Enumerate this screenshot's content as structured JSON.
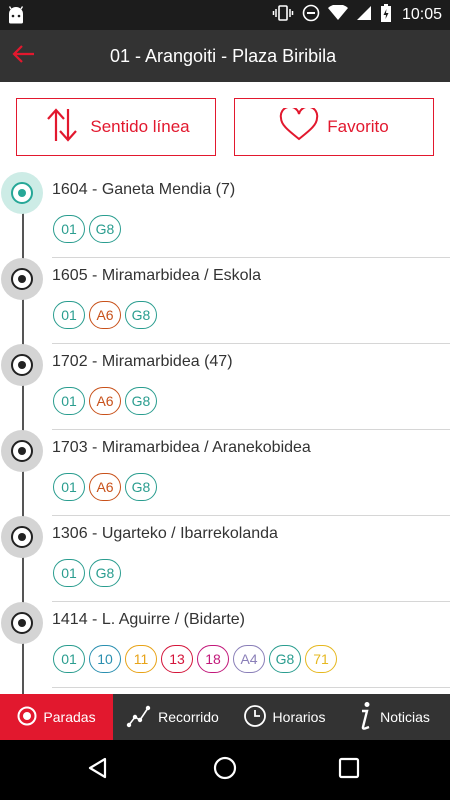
{
  "status_bar": {
    "time": "10:05",
    "icons": [
      "android-icon",
      "vibrate-icon",
      "minus-circle-icon",
      "wifi-icon",
      "signal-icon",
      "battery-icon"
    ]
  },
  "app_bar": {
    "title": "01 - Arangoiti - Plaza Biribila",
    "back_icon": "arrow-left-icon"
  },
  "actions": {
    "direction_label": "Sentido línea",
    "favorite_label": "Favorito"
  },
  "colors": {
    "accent": "#e2182e",
    "bar": "#333333",
    "active_stop": "#26a797"
  },
  "stops": [
    {
      "name": "1604 - Ganeta Mendia (7)",
      "active": true,
      "lines": [
        {
          "label": "01",
          "color": "#2a9d8f"
        },
        {
          "label": "G8",
          "color": "#2a9d8f"
        }
      ]
    },
    {
      "name": "1605 - Miramarbidea / Eskola",
      "active": false,
      "lines": [
        {
          "label": "01",
          "color": "#2a9d8f"
        },
        {
          "label": "A6",
          "color": "#c8511a"
        },
        {
          "label": "G8",
          "color": "#2a9d8f"
        }
      ]
    },
    {
      "name": "1702 - Miramarbidea (47)",
      "active": false,
      "lines": [
        {
          "label": "01",
          "color": "#2a9d8f"
        },
        {
          "label": "A6",
          "color": "#c8511a"
        },
        {
          "label": "G8",
          "color": "#2a9d8f"
        }
      ]
    },
    {
      "name": "1703 - Miramarbidea / Aranekobidea",
      "active": false,
      "lines": [
        {
          "label": "01",
          "color": "#2a9d8f"
        },
        {
          "label": "A6",
          "color": "#c8511a"
        },
        {
          "label": "G8",
          "color": "#2a9d8f"
        }
      ]
    },
    {
      "name": "1306 - Ugarteko / Ibarrekolanda",
      "active": false,
      "lines": [
        {
          "label": "01",
          "color": "#2a9d8f"
        },
        {
          "label": "G8",
          "color": "#2a9d8f"
        }
      ]
    },
    {
      "name": "1414 - L. Aguirre / (Bidarte)",
      "active": false,
      "lines": [
        {
          "label": "01",
          "color": "#2a9d8f"
        },
        {
          "label": "10",
          "color": "#2a8fb0"
        },
        {
          "label": "11",
          "color": "#e8a317"
        },
        {
          "label": "13",
          "color": "#d4153a"
        },
        {
          "label": "18",
          "color": "#c2187a"
        },
        {
          "label": "A4",
          "color": "#8a7fb8"
        },
        {
          "label": "G8",
          "color": "#2a9d8f"
        },
        {
          "label": "71",
          "color": "#e6b81f"
        }
      ]
    }
  ],
  "bottom_nav": [
    {
      "label": "Paradas",
      "icon": "stop-target-icon",
      "active": true
    },
    {
      "label": "Recorrido",
      "icon": "route-icon",
      "active": false
    },
    {
      "label": "Horarios",
      "icon": "clock-icon",
      "active": false
    },
    {
      "label": "Noticias",
      "icon": "info-icon",
      "active": false
    }
  ],
  "system_nav": [
    "back-triangle-icon",
    "home-circle-icon",
    "recents-square-icon"
  ]
}
